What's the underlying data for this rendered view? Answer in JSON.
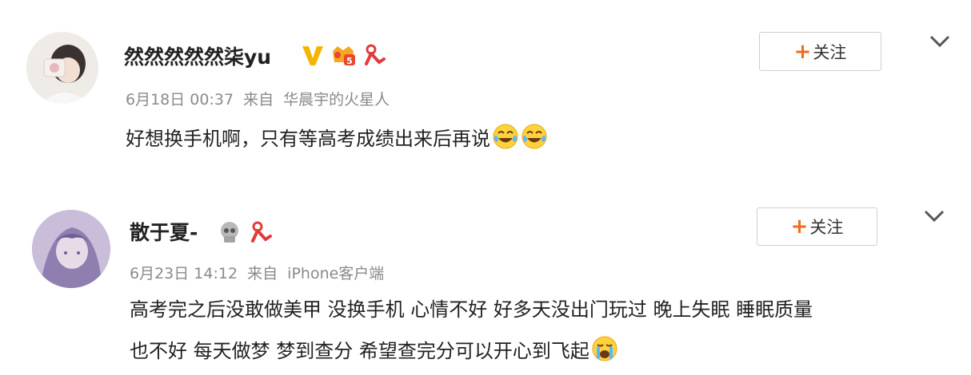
{
  "comments": [
    {
      "username": "然然然然然柒yu",
      "badges": [
        "verified-v-icon",
        "vip-level-5-icon",
        "fan-ribbon-icon"
      ],
      "date": "6月18日 00:37",
      "source_prefix": "来自",
      "source": "华晨宇的火星人",
      "content_lines": [
        "好想换手机啊，只有等高考成绩出来后再说"
      ],
      "emojis": [
        "laugh-cry-emoji",
        "laugh-cry-emoji"
      ],
      "follow_plus": "+",
      "follow_label": "关注"
    },
    {
      "username": "散于夏-",
      "badges": [
        "skull-badge-icon",
        "fan-ribbon-icon"
      ],
      "date": "6月23日 14:12",
      "source_prefix": "来自",
      "source": "iPhone客户端",
      "content_lines": [
        "高考完之后没敢做美甲 没换手机 心情不好 好多天没出门玩过 晚上失眠 睡眠质量",
        "也不好 每天做梦 梦到查分 希望查完分可以开心到飞起"
      ],
      "emojis": [
        "crying-emoji"
      ],
      "follow_plus": "+",
      "follow_label": "关注"
    }
  ]
}
